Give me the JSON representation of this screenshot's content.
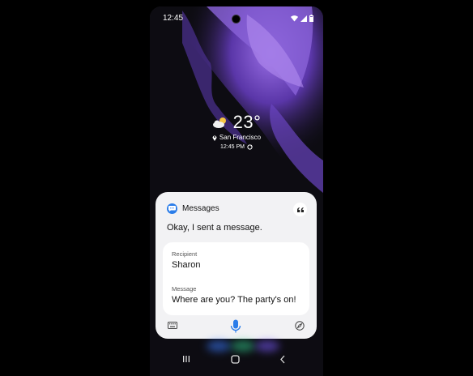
{
  "status_bar": {
    "time": "12:45"
  },
  "lock_screen": {
    "temperature": "23°",
    "location": "San Francisco",
    "updated_time": "12:45 PM"
  },
  "bixby_card": {
    "app_name": "Messages",
    "response": "Okay, I sent a message.",
    "recipient_label": "Recipient",
    "recipient_value": "Sharon",
    "message_label": "Message",
    "message_value": "Where are you? The party's on!"
  },
  "colors": {
    "accent": "#2b7de9",
    "card_bg": "#f2f2f4",
    "wallpaper_purple": "#7a4fd0"
  },
  "icons": [
    "messages-app-icon",
    "quote-icon",
    "keyboard-icon",
    "microphone-icon",
    "compass-icon",
    "recents-icon",
    "home-icon",
    "back-icon",
    "weather-partly-cloudy-icon",
    "location-pin-icon",
    "sync-icon",
    "wifi-icon",
    "signal-icon",
    "battery-icon"
  ]
}
